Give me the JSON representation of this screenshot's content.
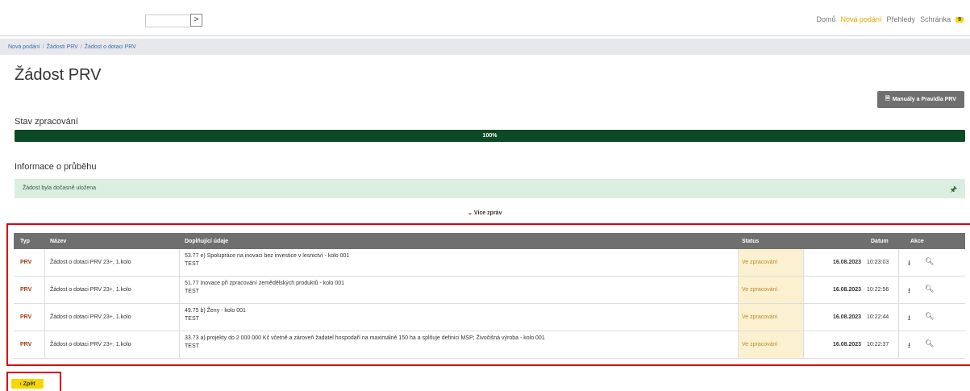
{
  "topbar": {
    "arrow_label": ">",
    "nav": [
      "Domů",
      "Nová podání",
      "Přehledy",
      "Schránka"
    ],
    "badge": "9"
  },
  "breadcrumb": [
    "Nová podání",
    "Žádosti PRV",
    "Žádost o dotaci PRV"
  ],
  "title": "Žádost PRV",
  "manual_button": "Manuály a Pravidla PRV",
  "progress": {
    "heading": "Stav zpracování",
    "label": "100%",
    "value": 1.0
  },
  "info": {
    "heading": "Informace o průběhu",
    "message": "Žádost byla dočasně uložena"
  },
  "more_messages": "Více zpráv",
  "table": {
    "headers": [
      "Typ",
      "Název",
      "Doplňující údaje",
      "Status",
      "Datum",
      "Akce"
    ],
    "rows": [
      {
        "type": "PRV",
        "name": "Žádost o dotaci PRV 23+, 1.kolo",
        "detail": "53.77 e) Spolupráce na inovaci bez investice v lesnictví - kolo 001",
        "detail2": "TEST",
        "status": "Ve zpracování",
        "date": "16.08.2023",
        "time": "10:23:03"
      },
      {
        "type": "PRV",
        "name": "Žádost o dotaci PRV 23+, 1.kolo",
        "detail": "51.77 Inovace při zpracování zemědělských produktů - kolo 001",
        "detail2": "TEST",
        "status": "Ve zpracování",
        "date": "16.08.2023",
        "time": "10:22:56"
      },
      {
        "type": "PRV",
        "name": "Žádost o dotaci PRV 23+, 1.kolo",
        "detail": "49.75 b) Ženy - kolo 001",
        "detail2": "TEST",
        "status": "Ve zpracování",
        "date": "16.08.2023",
        "time": "10:22:44"
      },
      {
        "type": "PRV",
        "name": "Žádost o dotaci PRV 23+, 1.kolo",
        "detail": "33.73 a) projekty do 2 000 000 Kč včetně a zároveň žadatel hospodaří na maximálně 150 ha a splňuje definici MSP; Živočišná výroba - kolo 001",
        "detail2": "TEST",
        "status": "Ve zpracování",
        "date": "16.08.2023",
        "time": "10:22:37"
      }
    ]
  },
  "back_button": "Zpět",
  "colors": {
    "progress": "#0c4a26",
    "header": "#6f6f6f",
    "status_bg": "#fbf1d0",
    "accent_yellow": "#f7d700",
    "highlight_red": "#d9000d"
  }
}
